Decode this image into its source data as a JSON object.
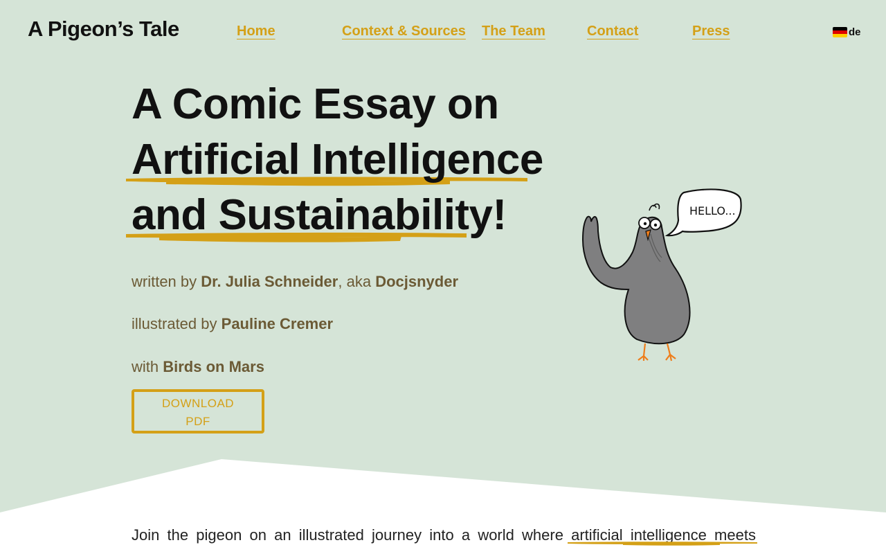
{
  "header": {
    "logo": "A Pigeon’s Tale",
    "nav": [
      {
        "label": "Home"
      },
      {
        "label": "Context & Sources"
      },
      {
        "label": "The Team"
      },
      {
        "label": "Contact"
      },
      {
        "label": "Press"
      }
    ],
    "language": "de"
  },
  "hero": {
    "line1": "A Comic Essay on",
    "line2": "Artificial Intelligence",
    "line3": "and Sustainability!",
    "written_prefix": "written by",
    "author": "Dr. Julia Schneider",
    "aka": ", aka",
    "alias": "Docjsnyder",
    "illustrated_prefix": "illustrated by",
    "illustrator": "Pauline Cremer",
    "with_prefix": "with",
    "partner": "Birds on Mars",
    "download_label": "DOWNLOAD PDF",
    "speech_bubble": "HELLO..."
  },
  "intro": {
    "words": [
      "Join",
      "the",
      "pigeon",
      "on",
      "an",
      "illustrated",
      "journey",
      "into",
      "a",
      "world",
      "where",
      "artificial",
      "intelligence",
      "meets"
    ]
  },
  "colors": {
    "background": "#d5e4d7",
    "accent": "#d4a017",
    "credit_text": "#6b5a35",
    "pigeon_gray": "#7f7f80"
  }
}
